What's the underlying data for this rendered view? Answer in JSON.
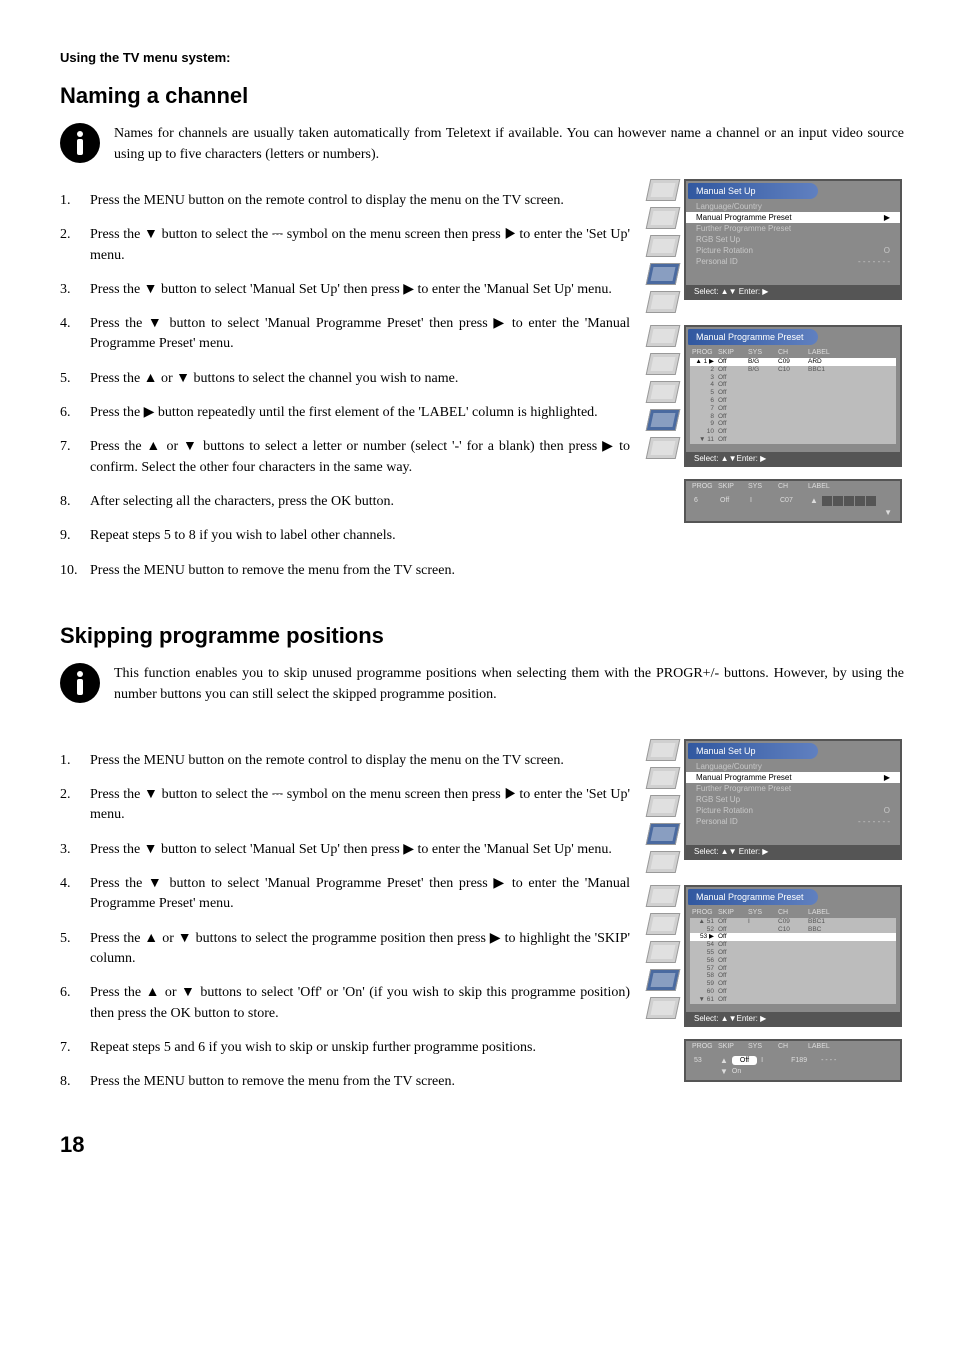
{
  "page": {
    "subheader": "Using the TV menu system:",
    "pageNumber": "18"
  },
  "section1": {
    "title": "Naming a channel",
    "info": "Names for channels are usually taken automatically from Teletext if available. You can however name a channel or an input video source using up to five characters (letters or numbers).",
    "steps": [
      "Press the MENU button on the remote control to display the menu on the TV screen.",
      "Press the ▼ button to select the ⎓ symbol on the menu screen then press ▶ to enter the 'Set Up' menu.",
      "Press the ▼ button to select 'Manual Set Up' then press ▶ to enter the 'Manual Set Up' menu.",
      "Press the ▼ button to select 'Manual Programme Preset' then press ▶ to enter the 'Manual Programme Preset' menu.",
      "Press the ▲ or ▼ buttons to select the channel you wish to name.",
      "Press the ▶ button repeatedly until the first element of the 'LABEL' column is highlighted.",
      "Press the ▲ or ▼ buttons to select a letter or number (select '-' for a blank) then press ▶ to confirm. Select the other four characters in the same way.",
      "After selecting all the characters, press the OK button.",
      "Repeat steps 5 to 8 if you wish to label other channels.",
      "Press the MENU button to remove the menu from the TV screen."
    ]
  },
  "section2": {
    "title": "Skipping programme positions",
    "info": "This function enables you to skip unused programme positions when selecting them with the PROGR+/- buttons. However, by using the number buttons you can still select the skipped programme position.",
    "steps": [
      "Press the MENU button on the remote control to display the menu on the TV screen.",
      "Press the ▼ button to select the ⎓ symbol on the menu screen then press ▶ to enter the 'Set Up' menu.",
      "Press the ▼ button to select 'Manual Set Up' then press ▶ to enter the 'Manual Set Up' menu.",
      "Press the ▼ button to select 'Manual Programme Preset' then press ▶ to enter the 'Manual Programme Preset' menu.",
      "Press the ▲ or ▼ buttons to select the programme position then press ▶ to highlight the 'SKIP' column.",
      "Press the ▲ or ▼ buttons to select 'Off' or 'On' (if you wish to skip this programme position) then press the OK button to store.",
      "Repeat steps 5 and 6 if you wish to skip or unskip further programme positions.",
      "Press the MENU button to remove the menu from the TV screen."
    ]
  },
  "tvmenu1": {
    "title": "Manual Set Up",
    "items": {
      "a": "Language/Country",
      "b": "Manual Programme Preset",
      "c": "Further Programme Preset",
      "d": "RGB Set Up",
      "e": "Picture Rotation",
      "eVal": "O",
      "f": "Personal ID",
      "fVal": "- - - - - - -"
    },
    "footer": "Select: ▲▼ Enter: ▶"
  },
  "tvmenu2": {
    "title": "Manual Programme Preset",
    "head": {
      "prog": "PROG",
      "skip": "SKIP",
      "sys": "SYS",
      "ch": "CH",
      "label": "LABEL"
    },
    "rows": [
      {
        "prog": "▲  1 ▶",
        "skip": "Off",
        "sys": "B/G",
        "ch": "C09",
        "label": "ARD"
      },
      {
        "prog": "2",
        "skip": "Off",
        "sys": "B/G",
        "ch": "C10",
        "label": "BBC1"
      },
      {
        "prog": "3",
        "skip": "Off",
        "sys": "",
        "ch": "",
        "label": ""
      },
      {
        "prog": "4",
        "skip": "Off",
        "sys": "",
        "ch": "",
        "label": ""
      },
      {
        "prog": "5",
        "skip": "Off",
        "sys": "",
        "ch": "",
        "label": ""
      },
      {
        "prog": "6",
        "skip": "Off",
        "sys": "",
        "ch": "",
        "label": ""
      },
      {
        "prog": "7",
        "skip": "Off",
        "sys": "",
        "ch": "",
        "label": ""
      },
      {
        "prog": "8",
        "skip": "Off",
        "sys": "",
        "ch": "",
        "label": ""
      },
      {
        "prog": "9",
        "skip": "Off",
        "sys": "",
        "ch": "",
        "label": ""
      },
      {
        "prog": "10",
        "skip": "Off",
        "sys": "",
        "ch": "",
        "label": ""
      },
      {
        "prog": "▼ 11",
        "skip": "Off",
        "sys": "",
        "ch": "",
        "label": ""
      }
    ],
    "footer": "Select: ▲▼Enter: ▶"
  },
  "detail1": {
    "head": {
      "prog": "PROG",
      "skip": "SKIP",
      "sys": "SYS",
      "ch": "CH",
      "label": "LABEL"
    },
    "row": {
      "prog": "6",
      "skip": "Off",
      "sys": "I",
      "ch": "C07"
    }
  },
  "tvmenu3": {
    "title": "Manual Set Up",
    "items": {
      "a": "Language/Country",
      "b": "Manual Programme Preset",
      "c": "Further Programme Preset",
      "d": "RGB Set Up",
      "e": "Picture Rotation",
      "eVal": "O",
      "f": "Personal ID",
      "fVal": "- - - - - - -"
    },
    "footer": "Select: ▲▼ Enter: ▶"
  },
  "tvmenu4": {
    "title": "Manual Programme Preset",
    "head": {
      "prog": "PROG",
      "skip": "SKIP",
      "sys": "SYS",
      "ch": "CH",
      "label": "LABEL"
    },
    "rows": [
      {
        "prog": "▲ 51",
        "skip": "Off",
        "sys": "I",
        "ch": "C09",
        "label": "BBC1"
      },
      {
        "prog": "52",
        "skip": "Off",
        "sys": "",
        "ch": "C10",
        "label": "BBC"
      },
      {
        "prog": "53 ▶",
        "skip": "Off",
        "sys": "",
        "ch": "",
        "label": ""
      },
      {
        "prog": "54",
        "skip": "Off",
        "sys": "",
        "ch": "",
        "label": ""
      },
      {
        "prog": "55",
        "skip": "Off",
        "sys": "",
        "ch": "",
        "label": ""
      },
      {
        "prog": "56",
        "skip": "Off",
        "sys": "",
        "ch": "",
        "label": ""
      },
      {
        "prog": "57",
        "skip": "Off",
        "sys": "",
        "ch": "",
        "label": ""
      },
      {
        "prog": "58",
        "skip": "Off",
        "sys": "",
        "ch": "",
        "label": ""
      },
      {
        "prog": "59",
        "skip": "Off",
        "sys": "",
        "ch": "",
        "label": ""
      },
      {
        "prog": "60",
        "skip": "Off",
        "sys": "",
        "ch": "",
        "label": ""
      },
      {
        "prog": "▼ 61",
        "skip": "Off",
        "sys": "",
        "ch": "",
        "label": ""
      }
    ],
    "footer": "Select: ▲▼Enter: ▶"
  },
  "detail2": {
    "head": {
      "prog": "PROG",
      "skip": "SKIP",
      "sys": "SYS",
      "ch": "CH",
      "label": "LABEL"
    },
    "row": {
      "prog": "53",
      "skipSel": "Off",
      "skipAlt": "On",
      "sys": "I",
      "ch": "F189",
      "label": "- - - -"
    }
  }
}
